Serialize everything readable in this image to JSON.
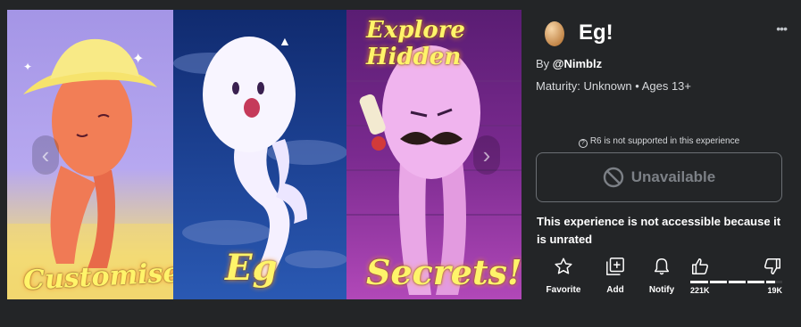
{
  "experience": {
    "title": "Eg!",
    "creator_prefix": "By ",
    "creator": "@Nimblz",
    "maturity": "Maturity: Unknown • Ages 13+"
  },
  "thumbnails": {
    "captions": [
      "Customise!",
      "Eg",
      "Secrets!",
      "Explore Hidden"
    ]
  },
  "play": {
    "notice": "R6 is not supported in this experience",
    "button_label": "Unavailable",
    "message": "This experience is not accessible because it is unrated"
  },
  "actions": [
    {
      "label": "Favorite",
      "icon": "star-icon"
    },
    {
      "label": "Add",
      "icon": "add-icon"
    },
    {
      "label": "Notify",
      "icon": "bell-icon"
    }
  ],
  "votes": {
    "up": "221K",
    "down": "19K",
    "up_fraction": 0.92
  },
  "colors": {
    "background": "#232527",
    "caption": "#fff46a",
    "muted": "#7c8086"
  }
}
